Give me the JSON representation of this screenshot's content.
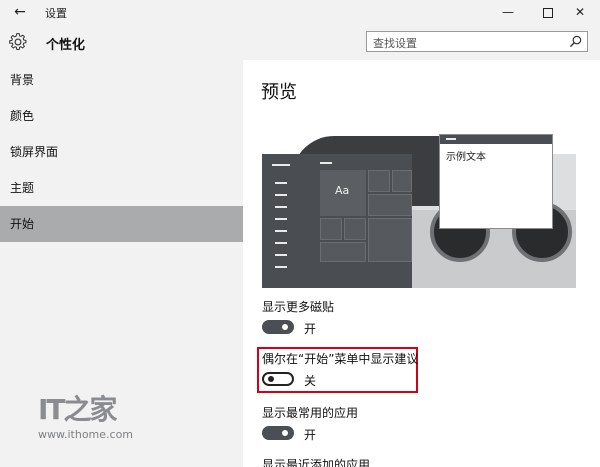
{
  "window": {
    "title": "设置",
    "back_glyph": "←",
    "minimize_glyph": "—",
    "close_glyph": "✕"
  },
  "header": {
    "title": "个性化",
    "search_placeholder": "查找设置"
  },
  "sidebar": {
    "items": [
      {
        "label": "背景",
        "active": false
      },
      {
        "label": "颜色",
        "active": false
      },
      {
        "label": "锁屏界面",
        "active": false
      },
      {
        "label": "主题",
        "active": false
      },
      {
        "label": "开始",
        "active": true
      }
    ]
  },
  "main": {
    "preview_title": "预览",
    "preview": {
      "tile_text": "Aa",
      "window_text": "示例文本"
    },
    "settings": [
      {
        "label": "显示更多磁贴",
        "state": "开",
        "on": true
      },
      {
        "label": "偶尔在“开始”菜单中显示建议",
        "state": "关",
        "on": false
      },
      {
        "label": "显示最常用的应用",
        "state": "开",
        "on": true
      }
    ],
    "cut_off_label": "显示最近添加的应用"
  },
  "watermark": {
    "logo": "IT之家",
    "url": "www.ithome.com"
  },
  "colors": {
    "sidebar_bg": "#f2f2f2",
    "active_item": "#a9abad",
    "toggle_on": "#4b4e52",
    "highlight": "#d0021b"
  }
}
